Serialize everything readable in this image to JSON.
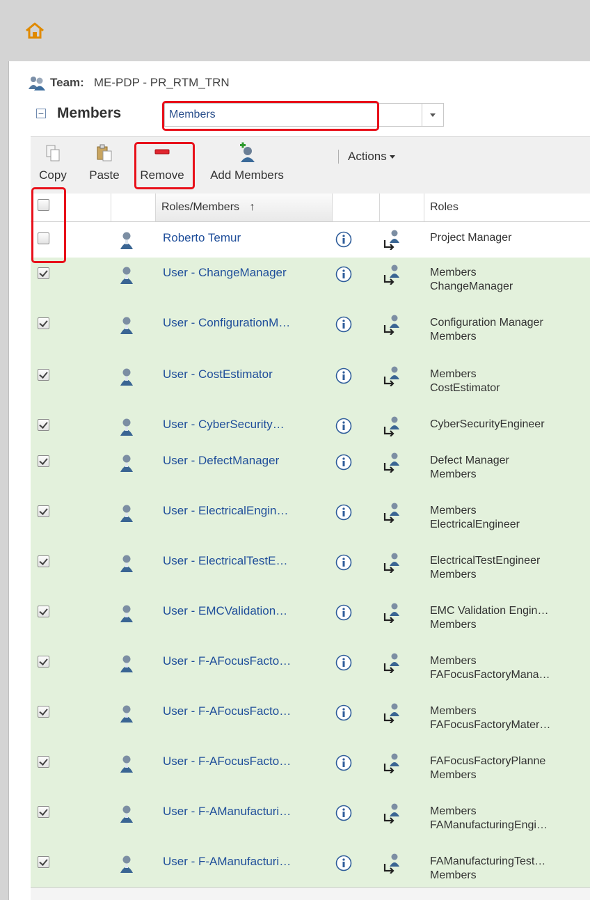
{
  "team": {
    "label": "Team:",
    "value": "ME-PDP - PR_RTM_TRN"
  },
  "members_section": {
    "title": "Members",
    "selected_view": "Members"
  },
  "toolbar": {
    "copy": "Copy",
    "paste": "Paste",
    "remove": "Remove",
    "add_members": "Add Members",
    "actions": "Actions"
  },
  "grid": {
    "columns": {
      "name": "Roles/Members",
      "sort_indicator": "↑",
      "roles": "Roles"
    },
    "rows": [
      {
        "name": "Roberto Temur",
        "roles": [
          "Project Manager"
        ],
        "checked": false
      },
      {
        "name": "User - ChangeManager",
        "roles": [
          "Members",
          "ChangeManager"
        ],
        "checked": true
      },
      {
        "name": "User - ConfigurationM…",
        "roles": [
          "Configuration Manager",
          "Members"
        ],
        "checked": true
      },
      {
        "name": "User - CostEstimator",
        "roles": [
          "Members",
          "CostEstimator"
        ],
        "checked": true
      },
      {
        "name": "User - CyberSecurity…",
        "roles": [
          "CyberSecurityEngineer"
        ],
        "checked": true
      },
      {
        "name": "User - DefectManager",
        "roles": [
          "Defect Manager",
          "Members"
        ],
        "checked": true
      },
      {
        "name": "User - ElectricalEngin…",
        "roles": [
          "Members",
          "ElectricalEngineer"
        ],
        "checked": true
      },
      {
        "name": "User - ElectricalTestE…",
        "roles": [
          "ElectricalTestEngineer",
          "Members"
        ],
        "checked": true
      },
      {
        "name": "User - EMCValidation…",
        "roles": [
          "EMC Validation Engin…",
          "Members"
        ],
        "checked": true
      },
      {
        "name": "User - F-AFocusFacto…",
        "roles": [
          "Members",
          "FAFocusFactoryMana…"
        ],
        "checked": true
      },
      {
        "name": "User - F-AFocusFacto…",
        "roles": [
          "Members",
          "FAFocusFactoryMater…"
        ],
        "checked": true
      },
      {
        "name": "User - F-AFocusFacto…",
        "roles": [
          "FAFocusFactoryPlanne",
          "Members"
        ],
        "checked": true
      },
      {
        "name": "User - F-AManufacturi…",
        "roles": [
          "Members",
          "FAManufacturingEngi…"
        ],
        "checked": true
      },
      {
        "name": "User - F-AManufacturi…",
        "roles": [
          "FAManufacturingTest…",
          "Members"
        ],
        "checked": true
      }
    ]
  },
  "colors": {
    "selected_row": "#e3f1dc",
    "link": "#1f4e9a",
    "highlight": "#e8101a",
    "toolbar": "#f0f0f0"
  }
}
